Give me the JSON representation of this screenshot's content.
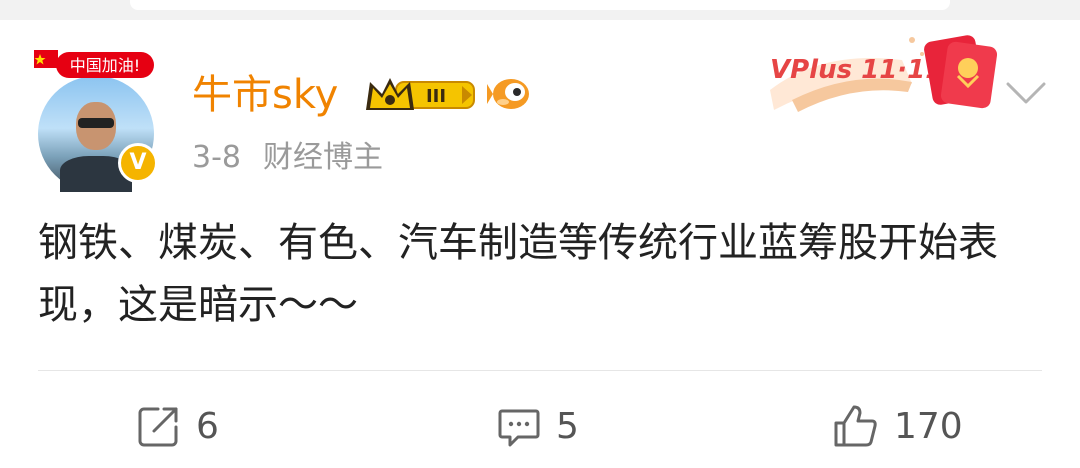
{
  "post": {
    "username": "牛市sky",
    "date": "3-8",
    "role": "财经博主",
    "content": "钢铁、煤炭、有色、汽车制造等传统行业蓝筹股开始表现，这是暗示～～",
    "badges": {
      "avatar_badge": "中国加油!",
      "level": "III",
      "verified": "V",
      "promo": "VPlus 11·11"
    }
  },
  "actions": {
    "repost": {
      "icon": "share-icon",
      "count": "6"
    },
    "comment": {
      "icon": "comment-icon",
      "count": "5"
    },
    "like": {
      "icon": "thumbs-up-icon",
      "count": "170"
    }
  },
  "colors": {
    "username": "#f08300",
    "meta": "#9a9a9a",
    "text": "#222222",
    "verified": "#f5b400"
  }
}
